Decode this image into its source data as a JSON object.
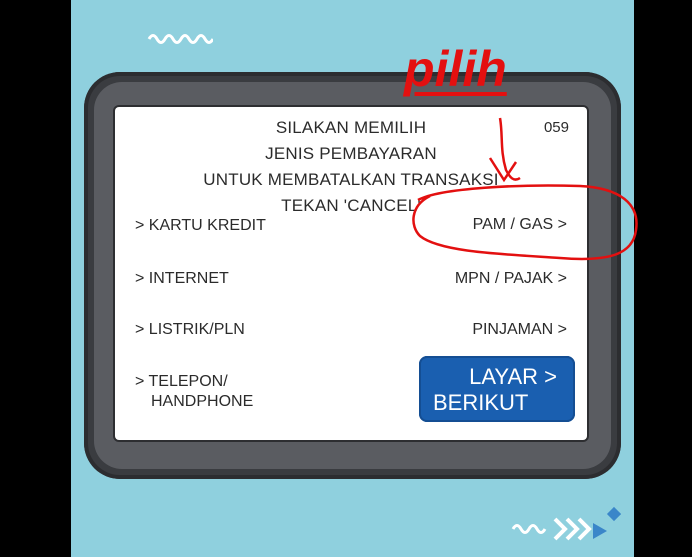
{
  "screen": {
    "code": "059",
    "header_lines": [
      "SILAKAN MEMILIH",
      "JENIS PEMBAYARAN",
      "UNTUK MEMBATALKAN TRANSAKSI",
      "TEKAN 'CANCEL'"
    ],
    "left_options": [
      {
        "label": "> KARTU KREDIT"
      },
      {
        "label": "> INTERNET"
      },
      {
        "label": "> LISTRIK/PLN"
      },
      {
        "label": "> TELEPON/",
        "label2": "HANDPHONE"
      }
    ],
    "right_options": [
      {
        "label": "PAM / GAS >"
      },
      {
        "label": "MPN / PAJAK >"
      },
      {
        "label": "PINJAMAN >"
      }
    ],
    "next_button": {
      "line1": "LAYAR >",
      "line2": "BERIKUT"
    }
  },
  "annotation": {
    "text": "pilih",
    "color": "#e31010"
  },
  "colors": {
    "background": "#8fd0de",
    "atm_frame": "#3a3c40",
    "button_blue": "#1a5fb0"
  }
}
